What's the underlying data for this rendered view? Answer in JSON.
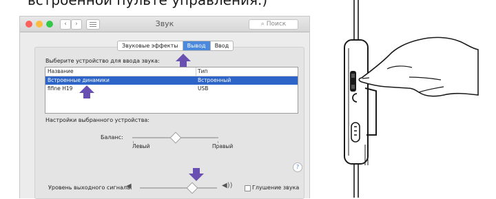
{
  "caption": "встроенной пульте управления.)",
  "window": {
    "title": "Звук",
    "search_placeholder": "Поиск",
    "nav_back": "‹",
    "nav_forward": "›"
  },
  "tabs": [
    {
      "label": "Звуковые эффекты",
      "active": false
    },
    {
      "label": "Вывод",
      "active": true
    },
    {
      "label": "Ввод",
      "active": false
    }
  ],
  "device_section": {
    "label": "Выберите устройство для ввода звука:",
    "columns": [
      "Название",
      "Тип"
    ],
    "rows": [
      {
        "name": "Встроенные динамики",
        "type": "Встроенный",
        "selected": true
      },
      {
        "name": "fifine H19",
        "type": "USB",
        "selected": false
      }
    ]
  },
  "settings": {
    "label": "Настройки выбранного устройства:",
    "balance_label": "Баланс:",
    "balance_left": "Левый",
    "balance_right": "Правый",
    "balance_value": 0.5
  },
  "help_label": "?",
  "output": {
    "label": "Уровень выходного сигнала:",
    "mute_label": "Глушение звука",
    "muted": false,
    "volume_value": 0.68,
    "icon_low": "speaker-low-icon",
    "icon_high": "speaker-high-icon"
  },
  "colors": {
    "selection": "#2c64c8",
    "tab_active": "#4a89dc",
    "arrow": "#6a4fb3"
  }
}
